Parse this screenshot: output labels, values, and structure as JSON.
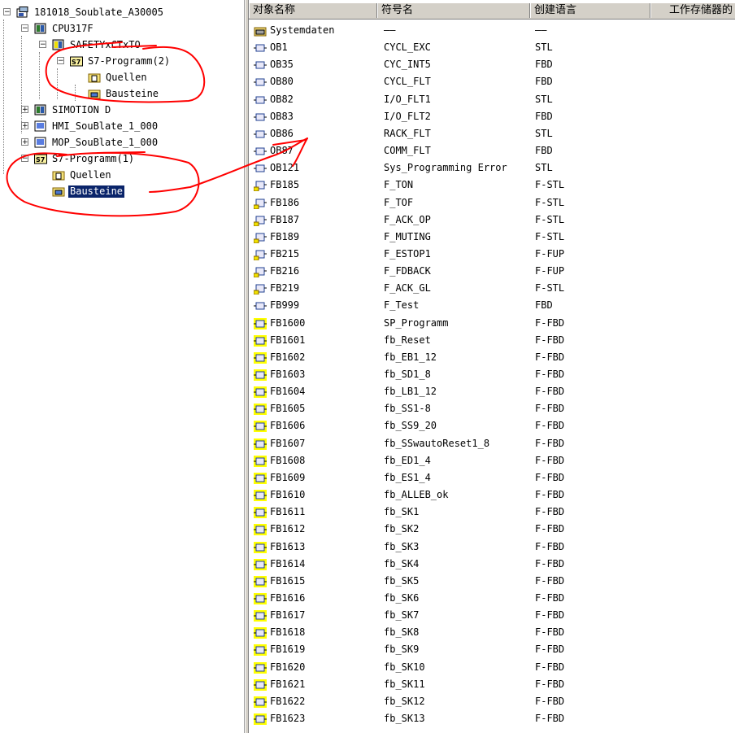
{
  "tree": [
    {
      "label": "181018_Soublate_A30005",
      "level": 0,
      "icon": "project-icon",
      "expander": "−"
    },
    {
      "label": "CPU317F",
      "level": 1,
      "icon": "cpu-icon",
      "expander": "−"
    },
    {
      "label": "SAFETYxCTxTO",
      "level": 2,
      "icon": "safety-cpu-icon",
      "expander": "−"
    },
    {
      "label": "S7-Programm(2)",
      "level": 3,
      "icon": "s7-program-icon",
      "expander": "−"
    },
    {
      "label": "Quellen",
      "level": 4,
      "icon": "sources-folder-icon",
      "expander": ""
    },
    {
      "label": "Bausteine",
      "level": 4,
      "icon": "blocks-folder-icon",
      "expander": ""
    },
    {
      "label": "SIMOTION D",
      "level": 1,
      "icon": "simotion-icon",
      "expander": "+"
    },
    {
      "label": "HMI_SouBlate_1_000",
      "level": 1,
      "icon": "hmi-icon",
      "expander": "+"
    },
    {
      "label": "MOP_SouBlate_1_000",
      "level": 1,
      "icon": "hmi-icon",
      "expander": "+"
    },
    {
      "label": "S7-Programm(1)",
      "level": 1,
      "icon": "s7-program-icon",
      "expander": "−"
    },
    {
      "label": "Quellen",
      "level": 2,
      "icon": "sources-folder-icon",
      "expander": ""
    },
    {
      "label": "Bausteine",
      "level": 2,
      "icon": "blocks-folder-icon",
      "expander": "",
      "selected": true
    }
  ],
  "columns": [
    "对象名称",
    "符号名",
    "创建语言",
    "工作存储器的"
  ],
  "rows": [
    {
      "name": "Systemdaten",
      "symbol": "——",
      "lang": "——",
      "icon": "system-data-icon"
    },
    {
      "name": "OB1",
      "symbol": "CYCL_EXC",
      "lang": "STL",
      "icon": "ob-block-icon"
    },
    {
      "name": "OB35",
      "symbol": "CYC_INT5",
      "lang": "FBD",
      "icon": "ob-block-icon"
    },
    {
      "name": "OB80",
      "symbol": "CYCL_FLT",
      "lang": "FBD",
      "icon": "ob-block-icon"
    },
    {
      "name": "OB82",
      "symbol": "I/O_FLT1",
      "lang": "STL",
      "icon": "ob-block-icon"
    },
    {
      "name": "OB83",
      "symbol": "I/O_FLT2",
      "lang": "FBD",
      "icon": "ob-block-icon"
    },
    {
      "name": "OB86",
      "symbol": "RACK_FLT",
      "lang": "STL",
      "icon": "ob-block-icon"
    },
    {
      "name": "OB87",
      "symbol": "COMM_FLT",
      "lang": "FBD",
      "icon": "ob-block-icon"
    },
    {
      "name": "OB121",
      "symbol": "Sys_Programming Error",
      "lang": "STL",
      "icon": "ob-block-icon"
    },
    {
      "name": "FB185",
      "symbol": "F_TON",
      "lang": "F-STL",
      "icon": "safety-fb-block-icon"
    },
    {
      "name": "FB186",
      "symbol": "F_TOF",
      "lang": "F-STL",
      "icon": "safety-fb-block-icon"
    },
    {
      "name": "FB187",
      "symbol": "F_ACK_OP",
      "lang": "F-STL",
      "icon": "safety-fb-block-icon"
    },
    {
      "name": "FB189",
      "symbol": "F_MUTING",
      "lang": "F-STL",
      "icon": "safety-fb-block-icon"
    },
    {
      "name": "FB215",
      "symbol": "F_ESTOP1",
      "lang": "F-FUP",
      "icon": "safety-fb-block-icon"
    },
    {
      "name": "FB216",
      "symbol": "F_FDBACK",
      "lang": "F-FUP",
      "icon": "safety-fb-block-icon"
    },
    {
      "name": "FB219",
      "symbol": "F_ACK_GL",
      "lang": "F-STL",
      "icon": "safety-fb-block-icon"
    },
    {
      "name": "FB999",
      "symbol": "F_Test",
      "lang": "FBD",
      "icon": "fb-block-icon"
    },
    {
      "name": "FB1600",
      "symbol": "SP_Programm",
      "lang": "F-FBD",
      "icon": "f-fb-block-icon"
    },
    {
      "name": "FB1601",
      "symbol": "fb_Reset",
      "lang": "F-FBD",
      "icon": "f-fb-block-icon"
    },
    {
      "name": "FB1602",
      "symbol": "fb_EB1_12",
      "lang": "F-FBD",
      "icon": "f-fb-block-icon"
    },
    {
      "name": "FB1603",
      "symbol": "fb_SD1_8",
      "lang": "F-FBD",
      "icon": "f-fb-block-icon"
    },
    {
      "name": "FB1604",
      "symbol": "fb_LB1_12",
      "lang": "F-FBD",
      "icon": "f-fb-block-icon"
    },
    {
      "name": "FB1605",
      "symbol": "fb_SS1-8",
      "lang": "F-FBD",
      "icon": "f-fb-block-icon"
    },
    {
      "name": "FB1606",
      "symbol": "fb_SS9_20",
      "lang": "F-FBD",
      "icon": "f-fb-block-icon"
    },
    {
      "name": "FB1607",
      "symbol": "fb_SSwautoReset1_8",
      "lang": "F-FBD",
      "icon": "f-fb-block-icon"
    },
    {
      "name": "FB1608",
      "symbol": "fb_ED1_4",
      "lang": "F-FBD",
      "icon": "f-fb-block-icon"
    },
    {
      "name": "FB1609",
      "symbol": "fb_ES1_4",
      "lang": "F-FBD",
      "icon": "f-fb-block-icon"
    },
    {
      "name": "FB1610",
      "symbol": "fb_ALLEB_ok",
      "lang": "F-FBD",
      "icon": "f-fb-block-icon"
    },
    {
      "name": "FB1611",
      "symbol": "fb_SK1",
      "lang": "F-FBD",
      "icon": "f-fb-block-icon"
    },
    {
      "name": "FB1612",
      "symbol": "fb_SK2",
      "lang": "F-FBD",
      "icon": "f-fb-block-icon"
    },
    {
      "name": "FB1613",
      "symbol": "fb_SK3",
      "lang": "F-FBD",
      "icon": "f-fb-block-icon"
    },
    {
      "name": "FB1614",
      "symbol": "fb_SK4",
      "lang": "F-FBD",
      "icon": "f-fb-block-icon"
    },
    {
      "name": "FB1615",
      "symbol": "fb_SK5",
      "lang": "F-FBD",
      "icon": "f-fb-block-icon"
    },
    {
      "name": "FB1616",
      "symbol": "fb_SK6",
      "lang": "F-FBD",
      "icon": "f-fb-block-icon"
    },
    {
      "name": "FB1617",
      "symbol": "fb_SK7",
      "lang": "F-FBD",
      "icon": "f-fb-block-icon"
    },
    {
      "name": "FB1618",
      "symbol": "fb_SK8",
      "lang": "F-FBD",
      "icon": "f-fb-block-icon"
    },
    {
      "name": "FB1619",
      "symbol": "fb_SK9",
      "lang": "F-FBD",
      "icon": "f-fb-block-icon"
    },
    {
      "name": "FB1620",
      "symbol": "fb_SK10",
      "lang": "F-FBD",
      "icon": "f-fb-block-icon"
    },
    {
      "name": "FB1621",
      "symbol": "fb_SK11",
      "lang": "F-FBD",
      "icon": "f-fb-block-icon"
    },
    {
      "name": "FB1622",
      "symbol": "fb_SK12",
      "lang": "F-FBD",
      "icon": "f-fb-block-icon"
    },
    {
      "name": "FB1623",
      "symbol": "fb_SK13",
      "lang": "F-FBD",
      "icon": "f-fb-block-icon"
    }
  ],
  "colors": {
    "selection": "#0a246a",
    "annotation": "#ff0000",
    "fblock_yellow": "#ffff00",
    "header_bg": "#d4d0c8"
  }
}
